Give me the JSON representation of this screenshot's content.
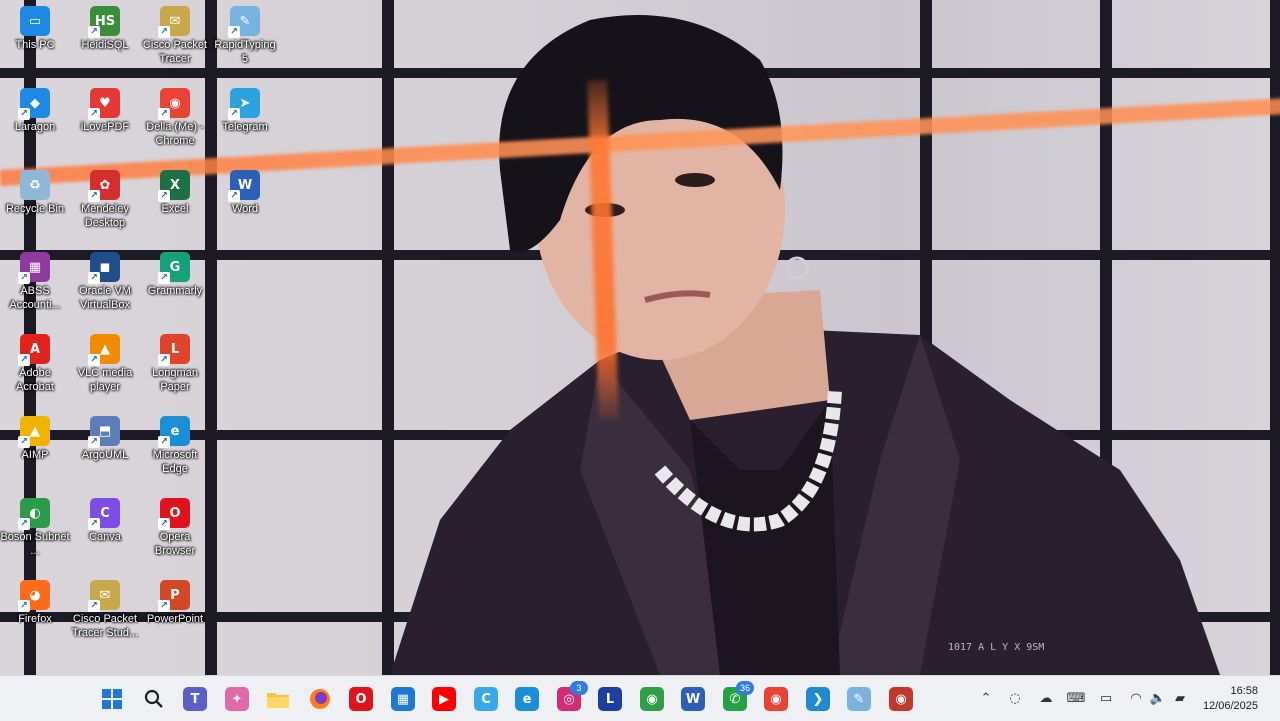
{
  "desktop": {
    "icons": [
      {
        "label": "This PC",
        "icon": "monitor-icon",
        "color": "#1e88e5"
      },
      {
        "label": "HeidiSQL",
        "icon": "heidisql-icon",
        "color": "#3a8d3a"
      },
      {
        "label": "Cisco Packet Tracer",
        "icon": "cisco-packet-tracer-icon",
        "color": "#c7a84a"
      },
      {
        "label": "RapidTyping 5",
        "icon": "rapidtyping-icon",
        "color": "#78b3e0"
      },
      {
        "label": "Laragon",
        "icon": "laragon-icon",
        "color": "#1e88e5"
      },
      {
        "label": "iLovePDF",
        "icon": "ilovepdf-icon",
        "color": "#e53935"
      },
      {
        "label": "Della (Me) - Chrome",
        "icon": "chrome-icon",
        "color": "#e84335"
      },
      {
        "label": "Telegram",
        "icon": "telegram-icon",
        "color": "#2aa3e0"
      },
      {
        "label": "Recycle Bin",
        "icon": "recycle-bin-icon",
        "color": "#8fb8d8"
      },
      {
        "label": "Mendeley Desktop",
        "icon": "mendeley-icon",
        "color": "#d32f2f"
      },
      {
        "label": "Excel",
        "icon": "excel-icon",
        "color": "#1d7044"
      },
      {
        "label": "Word",
        "icon": "word-icon",
        "color": "#2b5fb8"
      },
      {
        "label": "ABSS Accounti...",
        "icon": "abss-icon",
        "color": "#8e3a9e"
      },
      {
        "label": "Oracle VM VirtualBox",
        "icon": "virtualbox-icon",
        "color": "#1f4f8a"
      },
      {
        "label": "Grammarly",
        "icon": "grammarly-icon",
        "color": "#15a07a"
      },
      {
        "label": "Adobe Acrobat",
        "icon": "acrobat-icon",
        "color": "#e0241b"
      },
      {
        "label": "VLC media player",
        "icon": "vlc-icon",
        "color": "#f08c00"
      },
      {
        "label": "Longman Paper",
        "icon": "longman-icon",
        "color": "#e0442b"
      },
      {
        "label": "AIMP",
        "icon": "aimp-icon",
        "color": "#f0b400"
      },
      {
        "label": "ArgoUML",
        "icon": "argouml-icon",
        "color": "#5b7db8"
      },
      {
        "label": "Microsoft Edge",
        "icon": "edge-icon",
        "color": "#1a8fd6"
      },
      {
        "label": "Boson Subnet ...",
        "icon": "boson-icon",
        "color": "#2c9c4a"
      },
      {
        "label": "Canva",
        "icon": "canva-icon",
        "color": "#7d4ee6"
      },
      {
        "label": "Opera Browser",
        "icon": "opera-icon",
        "color": "#e0131d"
      },
      {
        "label": "Firefox",
        "icon": "firefox-icon",
        "color": "#ff6b1a"
      },
      {
        "label": "Cisco Packet Tracer Stud...",
        "icon": "cisco-packet-tracer-icon",
        "color": "#c7a84a"
      },
      {
        "label": "PowerPoint",
        "icon": "powerpoint-icon",
        "color": "#d24726"
      }
    ]
  },
  "wallpaper": {
    "jacket_text": "1017 A L Y X 9SM"
  },
  "taskbar": {
    "apps": [
      {
        "icon": "windows-start-icon",
        "glyph": "",
        "color": "#1e78d6"
      },
      {
        "icon": "search-icon",
        "glyph": "⌕",
        "color": "#333333"
      },
      {
        "icon": "teams-icon",
        "glyph": "T",
        "color": "#5b5fc7"
      },
      {
        "icon": "copilot-icon",
        "glyph": "✦",
        "color": "#e06aa8"
      },
      {
        "icon": "file-explorer-icon",
        "glyph": "",
        "color": "#f6c343"
      },
      {
        "icon": "firefox-icon",
        "glyph": "",
        "color": "#ff6b1a"
      },
      {
        "icon": "opera-icon",
        "glyph": "O",
        "color": "#e0131d"
      },
      {
        "icon": "microsoft-store-icon",
        "glyph": "▦",
        "color": "#1e78d6"
      },
      {
        "icon": "youtube-icon",
        "glyph": "▶",
        "color": "#ff0000"
      },
      {
        "icon": "clipchamp-icon",
        "glyph": "C",
        "color": "#3aa7e8"
      },
      {
        "icon": "edge-icon",
        "glyph": "e",
        "color": "#1a8fd6"
      },
      {
        "icon": "instagram-icon",
        "glyph": "◎",
        "color": "#d62976",
        "badge": "3"
      },
      {
        "icon": "lexicon-icon",
        "glyph": "L",
        "color": "#1f3fa0"
      },
      {
        "icon": "chrome-icon",
        "glyph": "◉",
        "color": "#2e9e47"
      },
      {
        "icon": "word-icon",
        "glyph": "W",
        "color": "#2b5fb8"
      },
      {
        "icon": "whatsapp-icon",
        "glyph": "✆",
        "color": "#25a244",
        "badge": "36"
      },
      {
        "icon": "chrome-profile-icon",
        "glyph": "◉",
        "color": "#e84335"
      },
      {
        "icon": "vscode-icon",
        "glyph": "❯",
        "color": "#1f8ad2"
      },
      {
        "icon": "rapidtyping-icon",
        "glyph": "✎",
        "color": "#78b3e0"
      },
      {
        "icon": "chrome-profile-icon",
        "glyph": "◉",
        "color": "#c0392b"
      }
    ],
    "tray": [
      {
        "icon": "chevron-up-icon",
        "glyph": "⌃"
      },
      {
        "icon": "sync-icon",
        "glyph": "◌"
      },
      {
        "icon": "cloud-off-icon",
        "glyph": "☁"
      },
      {
        "icon": "keyboard-icon",
        "glyph": "⌨"
      },
      {
        "icon": "screen-icon",
        "glyph": "▭"
      },
      {
        "icon": "wifi-icon",
        "glyph": "◠"
      },
      {
        "icon": "volume-icon",
        "glyph": "🔈"
      },
      {
        "icon": "battery-icon",
        "glyph": "▰"
      }
    ],
    "time": "16:58",
    "date": "12/06/2025"
  }
}
